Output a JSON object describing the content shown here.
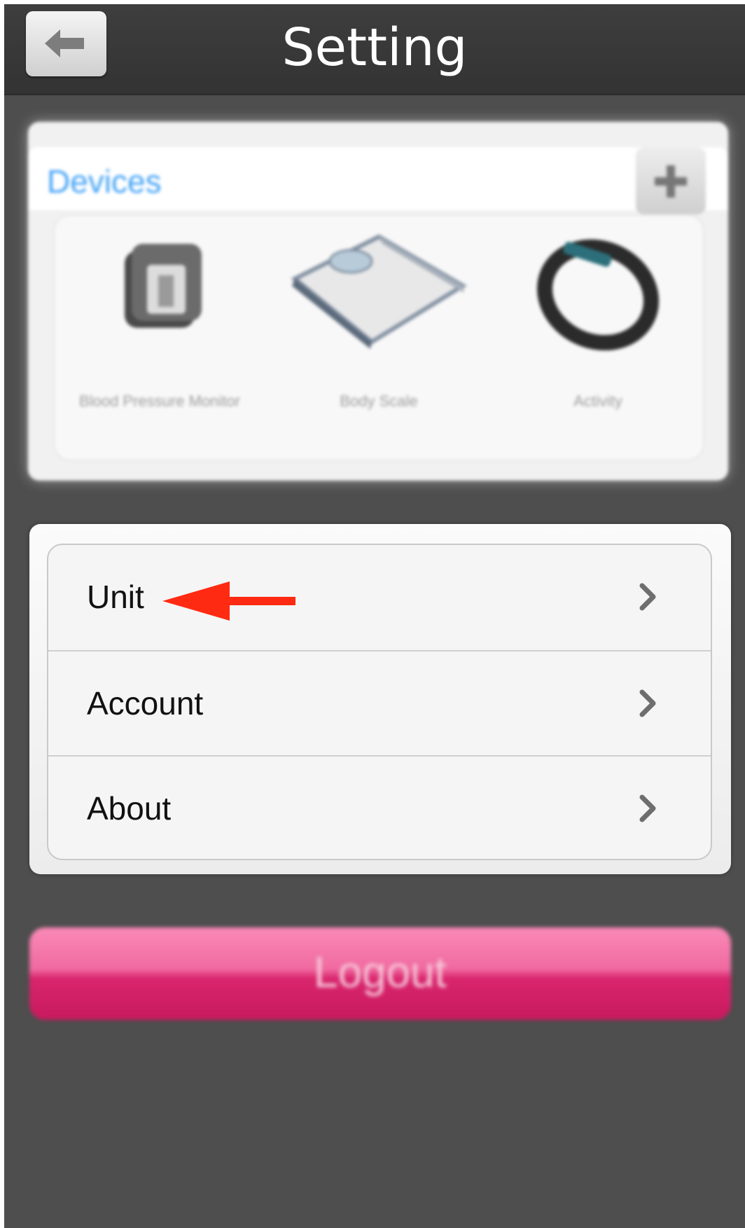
{
  "header": {
    "title": "Setting",
    "back_icon": "arrow-left-icon"
  },
  "devices": {
    "label": "Devices",
    "add_icon": "plus-icon",
    "items": [
      {
        "name": "Blood Pressure Monitor",
        "icon": "blood-pressure-monitor-icon"
      },
      {
        "name": "Body Scale",
        "icon": "body-scale-icon"
      },
      {
        "name": "Activity",
        "icon": "activity-band-icon"
      }
    ]
  },
  "settings": {
    "items": [
      {
        "label": "Unit",
        "icon": "chevron-right-icon"
      },
      {
        "label": "Account",
        "icon": "chevron-right-icon"
      },
      {
        "label": "About",
        "icon": "chevron-right-icon"
      }
    ]
  },
  "logout": {
    "label": "Logout"
  },
  "colors": {
    "devices_label": "#43a3f6",
    "logout_button": "#e84c8c",
    "annotation_arrow": "#ff2a12"
  }
}
